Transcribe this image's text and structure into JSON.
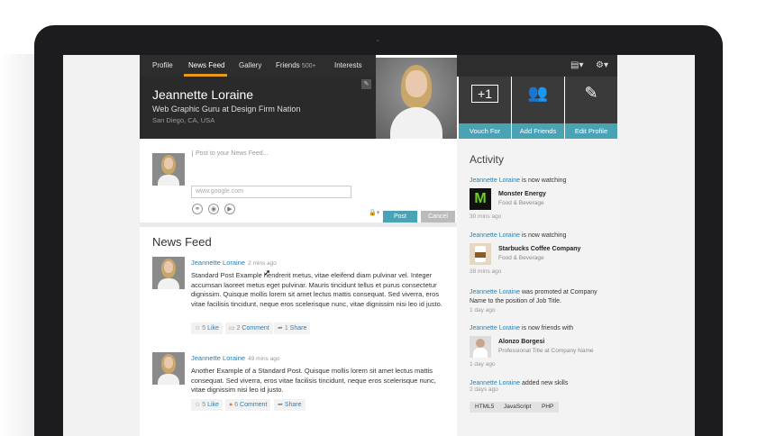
{
  "nav": {
    "items": [
      {
        "label": "Profile"
      },
      {
        "label": "News Feed"
      },
      {
        "label": "Gallery"
      },
      {
        "label": "Friends",
        "count": "500+"
      },
      {
        "label": "Interests"
      }
    ],
    "active": "News Feed",
    "accent_color": "#e59a1c"
  },
  "profile": {
    "name": "Jeannette Loraine",
    "title": "Web Graphic Guru at Design Firm Nation",
    "location": "San Diego, CA, USA"
  },
  "header_icons": {
    "document": "document-icon",
    "settings": "gear-icon"
  },
  "actions": [
    {
      "icon": "+1",
      "label": "Vouch For"
    },
    {
      "icon": "add-user-icon",
      "label": "Add Friends"
    },
    {
      "icon": "pencil-icon",
      "label": "Edit Profile"
    }
  ],
  "composer": {
    "placeholder": "Post to your News Feed...",
    "url_placeholder": "www.google.com",
    "post_label": "Post",
    "cancel_label": "Cancel"
  },
  "feed": {
    "title": "News Feed",
    "posts": [
      {
        "author": "Jeannette Loraine",
        "time": "2 mins ago",
        "body": "Standard Post Example hendrerit metus, vitae eleifend diam pulvinar vel. Integer accumsan laoreet metus eget pulvinar. Mauris tincidunt tellus et purus consectetur dignissim. Quisque mollis lorem sit amet lectus mattis consequat. Sed viverra, eros vitae facilisis tincidunt, neque eros scelerisque nunc, vitae dignissim nisi leo id justo.",
        "likes": "5",
        "like_label": "Like",
        "comments": "2",
        "comment_label": "Comment",
        "shares": "1",
        "share_label": "Share"
      },
      {
        "author": "Jeannette Loraine",
        "time": "49 mins ago",
        "body": "Another Example of a Standard Post. Quisque mollis lorem sit amet lectus mattis consequat. Sed viverra, eros vitae facilisis tincidunt, neque eros scelerisque nunc, vitae dignissim nisi leo id justo.",
        "likes": "5",
        "like_label": "Like",
        "comments": "6",
        "comment_label": "Comment",
        "shares": "",
        "share_label": "Share"
      }
    ]
  },
  "activity": {
    "title": "Activity",
    "items": [
      {
        "who": "Jeannette Loraine",
        "text": "is now watching",
        "entity": "Monster Energy",
        "entity_sub": "Food & Beverage",
        "ago": "30 mins ago"
      },
      {
        "who": "Jeannette Loraine",
        "text": "is now watching",
        "entity": "Starbucks Coffee Company",
        "entity_sub": "Food & Beverage",
        "ago": "38 mins ago"
      },
      {
        "who": "Jeannette Loraine",
        "text": "was promoted at Company Name to the position of Job Title.",
        "ago": "1 day ago"
      },
      {
        "who": "Jeannette Loraine",
        "text": "is now friends with",
        "entity": "Alonzo Borgesi",
        "entity_sub": "Professional Title at Company Name",
        "ago": "1 day ago"
      },
      {
        "who": "Jeannette Loraine",
        "text": "added new skills",
        "ago": "2 days ago",
        "tags": [
          "HTML5",
          "JavaScript",
          "PHP"
        ]
      }
    ]
  },
  "colors": {
    "teal": "#4aa3b5",
    "link": "#2a7fb5",
    "dark": "#2d2d2d"
  }
}
